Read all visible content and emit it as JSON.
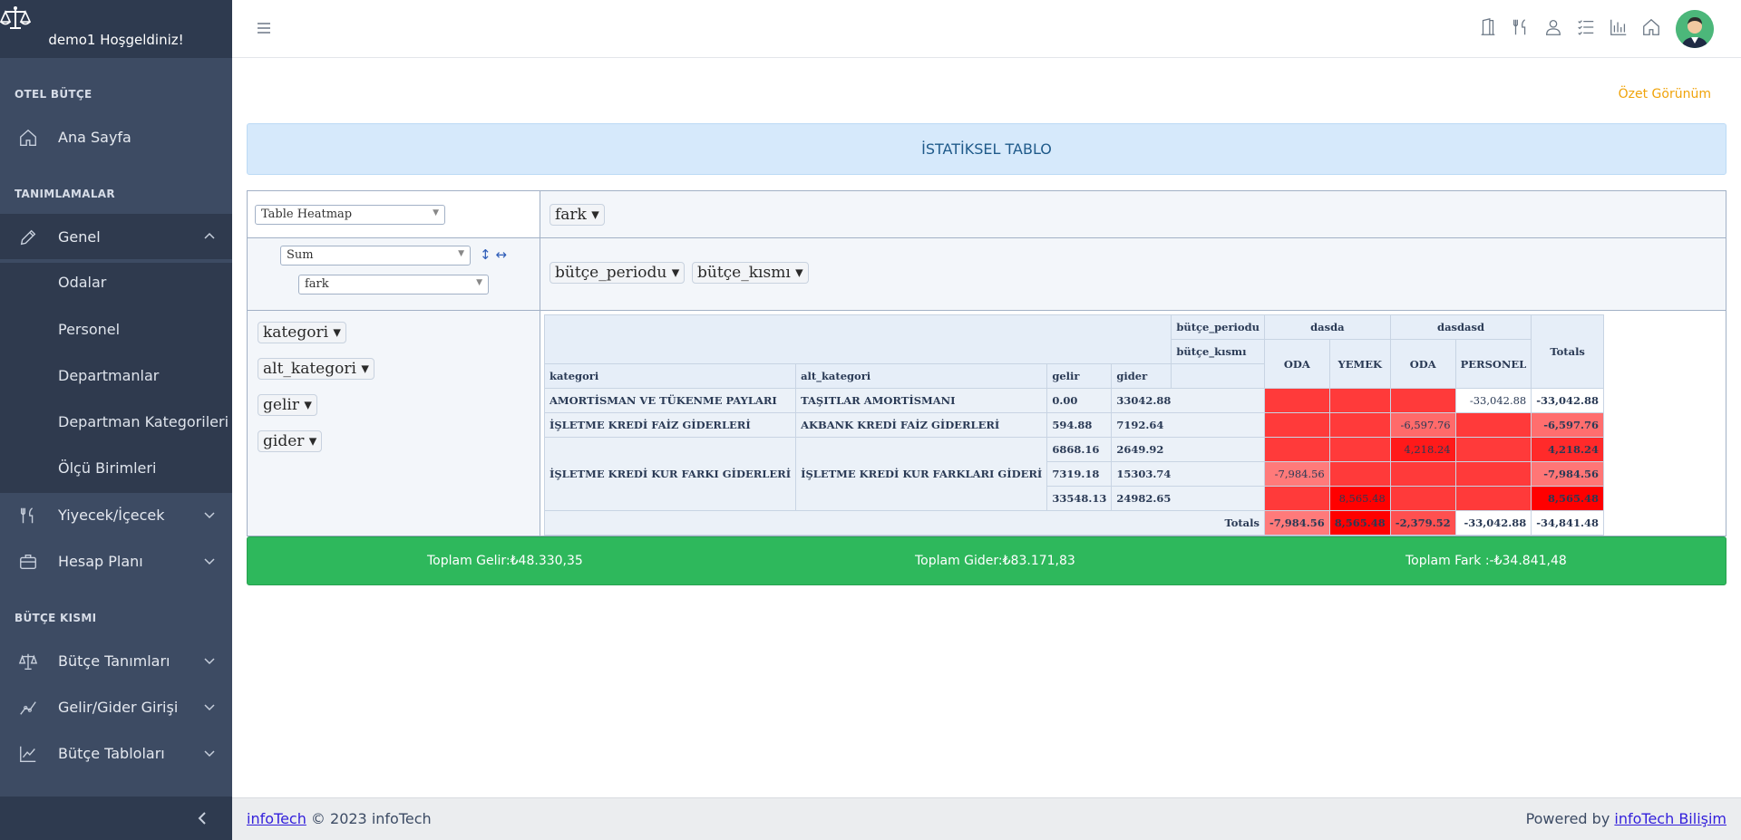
{
  "sidebar": {
    "welcome": "demo1 Hoşgeldiniz!",
    "sections": [
      "OTEL BÜTÇE",
      "TANIMLAMALAR",
      "BÜTÇE KISMI"
    ],
    "items": {
      "home": "Ana Sayfa",
      "genel": "Genel",
      "food": "Yiyecek/İçecek",
      "account": "Hesap Planı",
      "budget_defs": "Bütçe Tanımları",
      "income_entry": "Gelir/Gider Girişi",
      "budget_tables": "Bütçe Tabloları"
    },
    "genel_sub": [
      "Odalar",
      "Personel",
      "Departmanlar",
      "Departman Kategorileri",
      "Ölçü Birimleri"
    ]
  },
  "topbar": {
    "icons": [
      "door-icon",
      "utensils-icon",
      "user-icon",
      "list-icon",
      "bar-chart-icon",
      "home-icon"
    ]
  },
  "main": {
    "ozet_link": "Özet Görünüm",
    "title": "İSTATİKSEL TABLO"
  },
  "pivot": {
    "renderer": "Table Heatmap",
    "aggregator": "Sum",
    "agg_field": "fark",
    "vals_pill": "fark ▾",
    "col_pills": [
      "bütçe_periodu ▾",
      "bütçe_kısmı ▾"
    ],
    "row_pills": [
      "kategori ▾",
      "alt_kategori ▾",
      "gelir ▾",
      "gider ▾"
    ],
    "col_attr_labels": [
      "bütçe_periodu",
      "bütçe_kısmı"
    ],
    "row_attr_labels": [
      "kategori",
      "alt_kategori",
      "gelir",
      "gider"
    ],
    "periods": [
      "dasda",
      "dasdasd"
    ],
    "kisim": [
      "ODA",
      "YEMEK",
      "ODA",
      "PERSONEL"
    ],
    "totals_label": "Totals",
    "rows": [
      {
        "kategori": "AMORTİSMAN VE TÜKENME PAYLARI",
        "alt": "TAŞITLAR AMORTİSMANI",
        "gelir": "0.00",
        "gider": "33042.88",
        "cells": [
          "",
          "",
          "",
          "-33,042.88"
        ],
        "total": "-33,042.88"
      },
      {
        "kategori": "İŞLETME KREDİ FAİZ GİDERLERİ",
        "alt": "AKBANK KREDİ FAİZ GİDERLERİ",
        "gelir": "594.88",
        "gider": "7192.64",
        "cells": [
          "",
          "",
          "-6,597.76",
          ""
        ],
        "total": "-6,597.76"
      },
      {
        "kategori": "İŞLETME KREDİ KUR FARKI GİDERLERİ",
        "alt": "İŞLETME KREDİ KUR FARKLARI GİDERİ",
        "gelir": "6868.16",
        "gider": "2649.92",
        "cells": [
          "",
          "",
          "4,218.24",
          ""
        ],
        "total": "4,218.24"
      },
      {
        "kategori": "",
        "alt": "",
        "gelir": "7319.18",
        "gider": "15303.74",
        "cells": [
          "-7,984.56",
          "",
          "",
          ""
        ],
        "total": "-7,984.56"
      },
      {
        "kategori": "",
        "alt": "",
        "gelir": "33548.13",
        "gider": "24982.65",
        "cells": [
          "",
          "8,565.48",
          "",
          ""
        ],
        "total": "8,565.48"
      }
    ],
    "col_totals": [
      "-7,984.56",
      "8,565.48",
      "-2,379.52",
      "-33,042.88"
    ],
    "grand_total": "-34,841.48"
  },
  "summary": {
    "gelir": "Toplam Gelir:₺48.330,35",
    "gider": "Toplam Gider:₺83.171,83",
    "fark": "Toplam Fark :-₺34.841,48"
  },
  "footer": {
    "brand_link": "infoTech",
    "copyright": " © 2023 infoTech",
    "powered": "Powered by ",
    "powered_link": "infoTech Bilişim"
  },
  "colors": {
    "sidebar": "#3d4b63",
    "heat_strong": "#ff0000",
    "heat_mid": "#ff3a3a",
    "heat_light": "#ff7a7a",
    "summary_green": "#2eb85c",
    "accent_orange": "#f0a30a"
  }
}
